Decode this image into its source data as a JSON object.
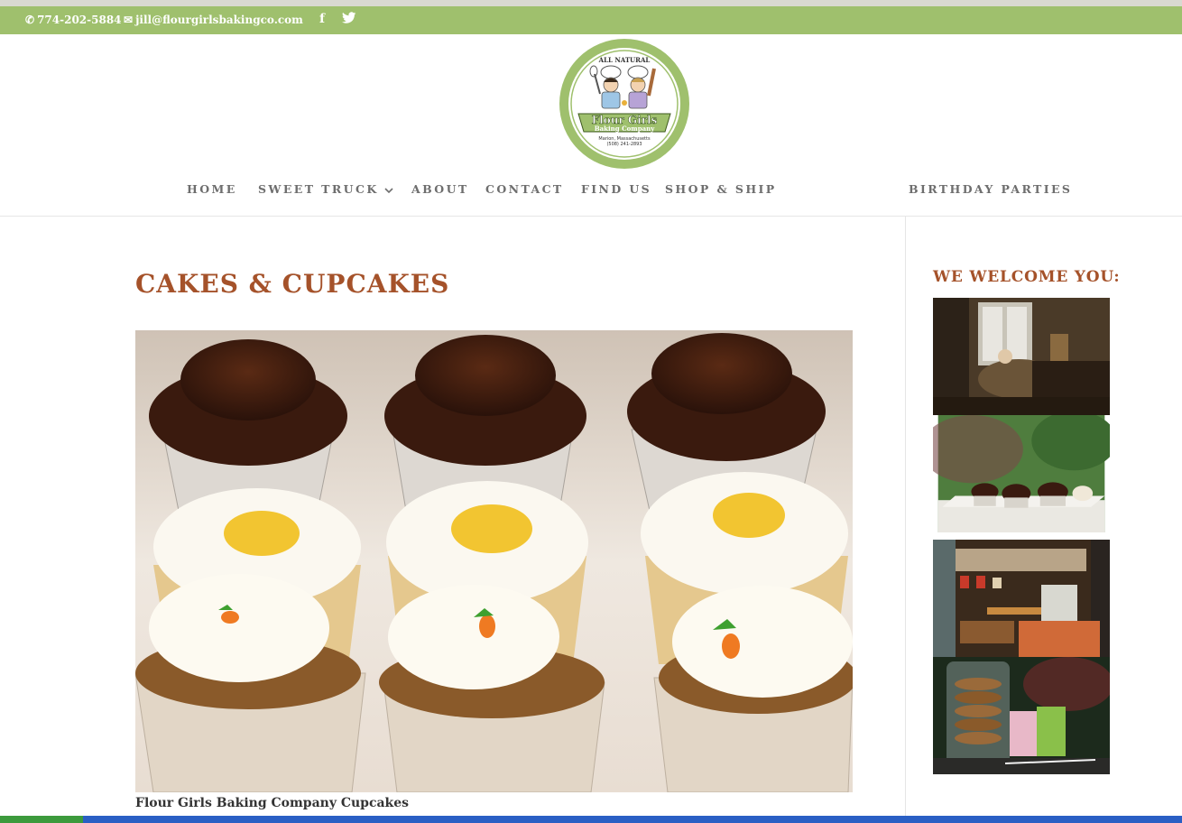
{
  "topbar": {
    "phone": "774-202-5884",
    "email": "jill@flourgirlsbakingco.com",
    "social_icons": [
      "facebook-icon",
      "twitter-icon"
    ]
  },
  "logo": {
    "top_text": "ALL NATURAL",
    "name_line1": "Flour Girls",
    "name_line2": "Baking Company",
    "location": "Marion, Massachusetts",
    "phone": "(508) 241-2893"
  },
  "nav": {
    "items": [
      "HOME",
      "SWEET TRUCK",
      "ABOUT",
      "CONTACT",
      "FIND US",
      "SHOP & SHIP",
      "BIRTHDAY PARTIES"
    ]
  },
  "content": {
    "title": "CAKES & CUPCAKES",
    "caption": "Flour Girls Baking Company Cupcakes"
  },
  "sidebar": {
    "title": "WE WELCOME YOU:"
  },
  "colors": {
    "accent_green": "#9fc06d",
    "title_brown": "#a5522a",
    "nav_gray": "#6e6e6e"
  }
}
